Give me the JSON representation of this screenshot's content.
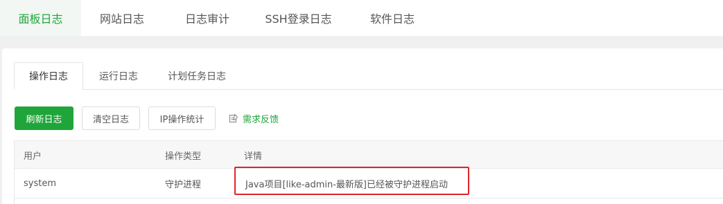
{
  "top_tabs": [
    {
      "label": "面板日志",
      "active": true
    },
    {
      "label": "网站日志",
      "active": false
    },
    {
      "label": "日志审计",
      "active": false
    },
    {
      "label": "SSH登录日志",
      "active": false
    },
    {
      "label": "软件日志",
      "active": false
    }
  ],
  "sub_tabs": [
    {
      "label": "操作日志",
      "active": true
    },
    {
      "label": "运行日志",
      "active": false
    },
    {
      "label": "计划任务日志",
      "active": false
    }
  ],
  "toolbar": {
    "refresh_label": "刷新日志",
    "clear_label": "清空日志",
    "ip_stats_label": "IP操作统计",
    "feedback_label": "需求反馈",
    "feedback_icon": "edit-icon"
  },
  "table": {
    "headers": [
      "用户",
      "操作类型",
      "详情"
    ],
    "rows": [
      {
        "user": "system",
        "type": "守护进程",
        "detail": "Java项目[like-admin-最新版]已经被守护进程启动"
      }
    ]
  },
  "colors": {
    "accent": "#20a53a",
    "highlight_border": "#e0232b"
  }
}
